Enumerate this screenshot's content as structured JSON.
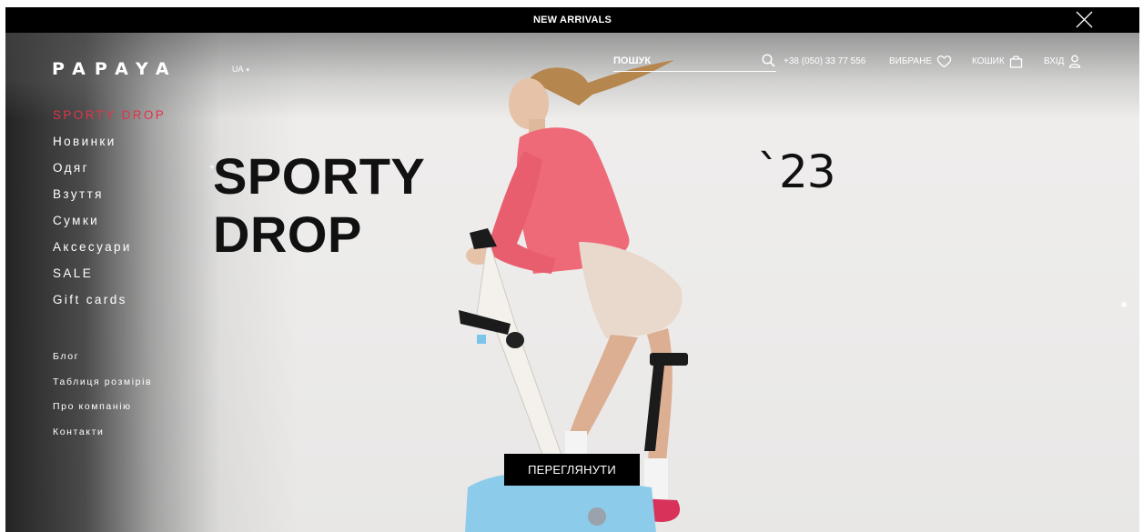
{
  "banner": {
    "text": "NEW ARRIVALS"
  },
  "header": {
    "logo": "PAPAYA",
    "lang": "UA",
    "lang_caret": "▾",
    "search_placeholder": "ПОШУК",
    "phone": "+38 (050) 33 77 556",
    "favorites": "ВИБРАНЕ",
    "cart": "КОШИК",
    "login": "ВХІД"
  },
  "menu": {
    "primary": [
      "SPORTY DROP",
      "Новинки",
      "Одяг",
      "Взуття",
      "Сумки",
      "Аксесуари",
      "SALE",
      "Gift cards"
    ],
    "secondary": [
      "Блог",
      "Таблиця розмірів",
      "Про компанію",
      "Контакти"
    ]
  },
  "hero": {
    "headline_line1": "SPORTY",
    "headline_line2": "DROP",
    "year": "`23",
    "plus": "+",
    "cta": "ПЕРЕГЛЯНУТИ"
  },
  "icons": [
    "close-icon",
    "search-icon",
    "heart-icon",
    "bag-icon",
    "user-icon"
  ],
  "colors": {
    "accent": "#e2324a",
    "banner_bg": "#000000",
    "cta_bg": "#000000"
  }
}
